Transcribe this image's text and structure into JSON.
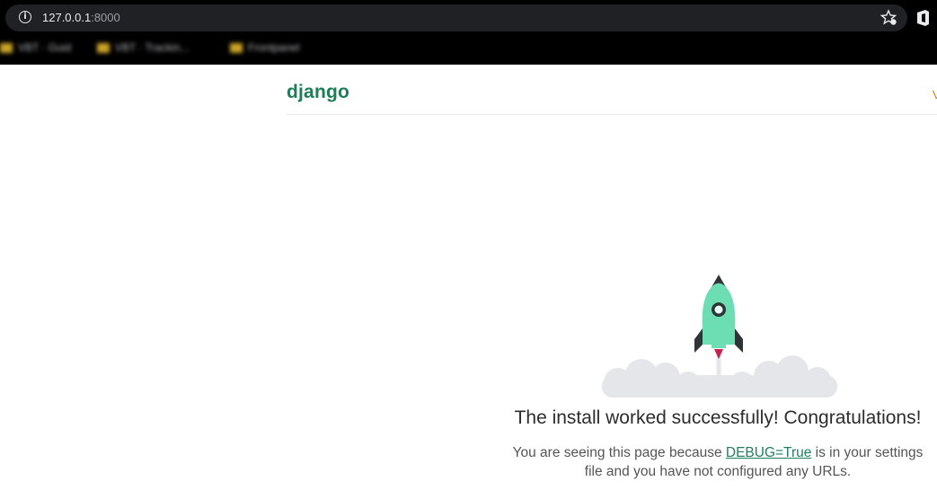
{
  "browser": {
    "url_host": "127.0.0.1",
    "url_port": ":8000",
    "bookmarks": [
      {
        "label": "VBT · Guid"
      },
      {
        "label": "VBT · Trackin..."
      },
      {
        "label": "Frontpanel"
      }
    ]
  },
  "page": {
    "logo": "django",
    "release_link": "V",
    "title": "The install worked successfully! Congratulations!",
    "sub_before": "You are seeing this page because ",
    "sub_link": "DEBUG=True",
    "sub_after": " is in your settings file and you have not configured any URLs."
  },
  "colors": {
    "brand_green": "#1a7f56",
    "rocket_body": "#6dddb4",
    "cloud": "#e4e6ea"
  }
}
